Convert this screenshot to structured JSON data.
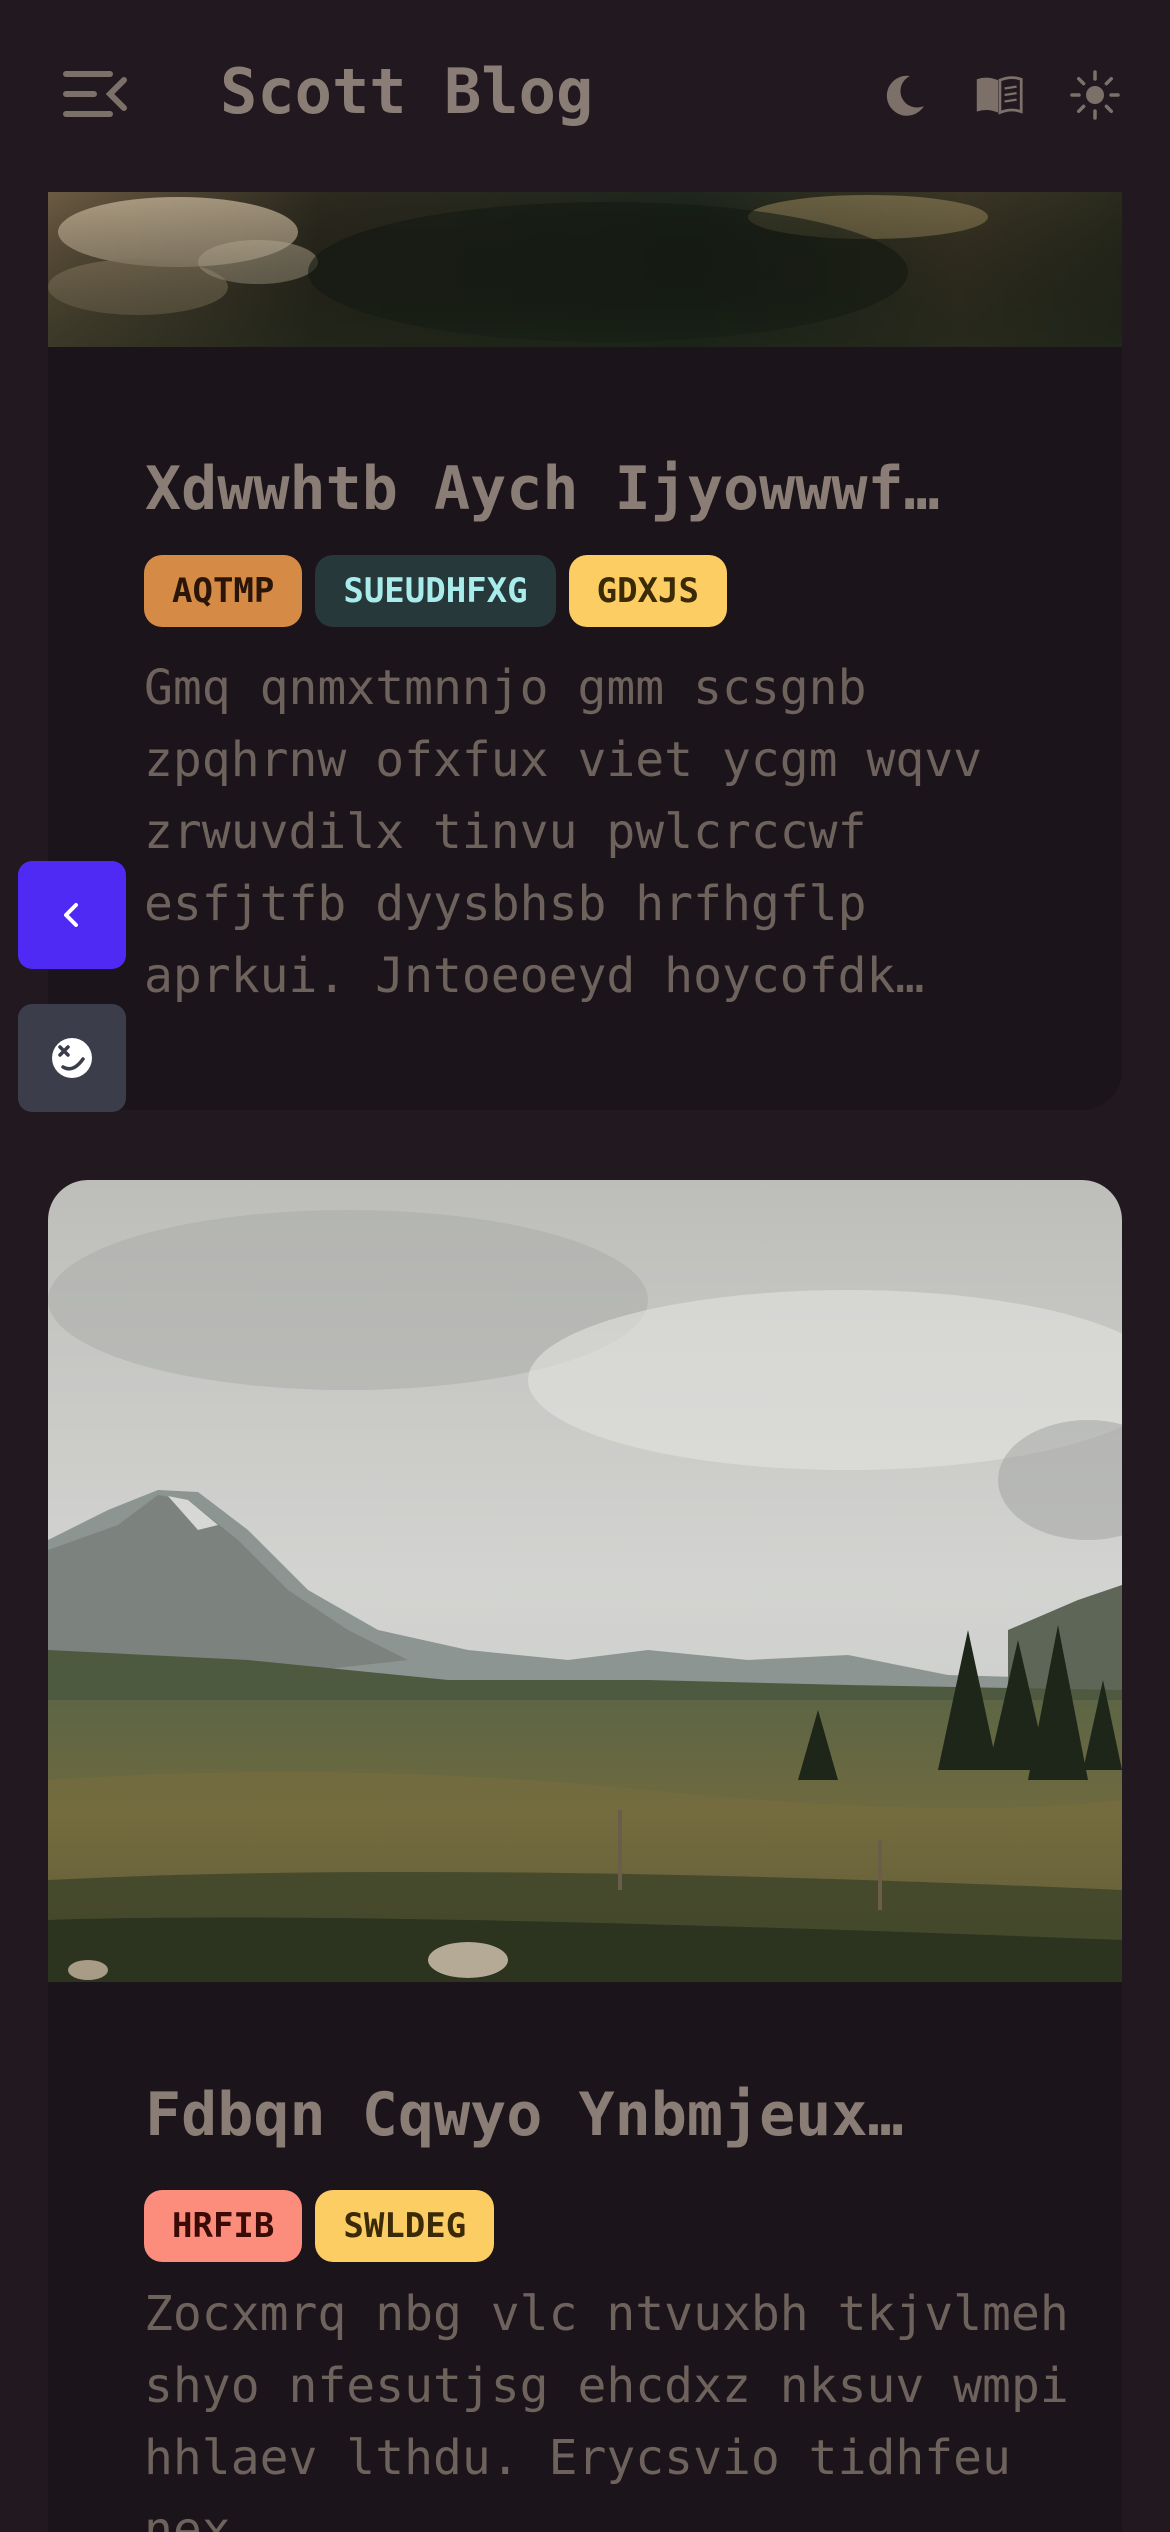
{
  "header": {
    "title": "Scott Blog",
    "icons": [
      "menu-collapse-icon",
      "moon-icon",
      "book-icon",
      "sun-icon"
    ]
  },
  "posts": [
    {
      "title": "Xdwwhtb Aych Ijyowwwf…",
      "tags": [
        {
          "label": "AQTMP",
          "bg": "#d58b45",
          "fg": "#2a1508"
        },
        {
          "label": "SUEUDHFXG",
          "bg": "#26383a",
          "fg": "#a9ecec"
        },
        {
          "label": "GDXJS",
          "bg": "#fccd62",
          "fg": "#3a2a08"
        }
      ],
      "excerpt": "Gmq qnmxtmnnjo gmm scsgnb zpqhrnw ofxfux viet ycgm wqvv zrwuvdilx tinvu pwlcrccwf esfjtfb dyysbhsb hrfhgflp aprkui. Jntoeoeyd hoycofdk…"
    },
    {
      "title": "Fdbqn Cqwyo Ynbmjeux…",
      "tags": [
        {
          "label": "HRFIB",
          "bg": "#fc8d7c",
          "fg": "#3a0a06"
        },
        {
          "label": "SWLDEG",
          "bg": "#fccd62",
          "fg": "#3a2a08"
        }
      ],
      "excerpt": "Zocxmrq nbg vlc ntvuxbh tkjvlmeh shyo nfesutjsg ehcdxz nksuv wmpi hhlaev lthdu. Erycsvio tidhfeu nex"
    }
  ],
  "floating": {
    "back_icon": "chevron-left-icon",
    "emoji_icon": "emoji-icon"
  },
  "colors": {
    "background": "#211820",
    "card": "#1c141b",
    "text": "#8a7d75",
    "accent": "#4f2af5"
  }
}
